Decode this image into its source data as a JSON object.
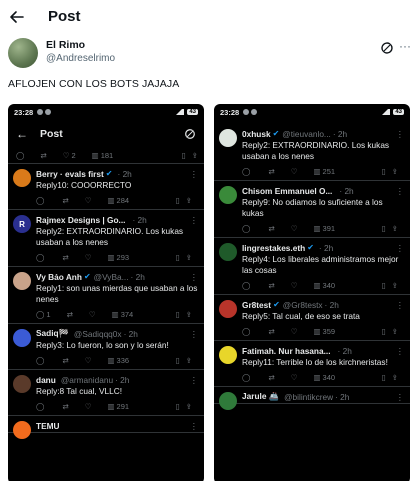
{
  "header": {
    "title": "Post"
  },
  "author": {
    "name": "El Rimo",
    "handle": "@Andreselrimo"
  },
  "tweet": {
    "text": "AFLOJEN CON LOS BOTS JAJAJA"
  },
  "screenshots": {
    "left": {
      "status_time": "23:28",
      "battery": "43",
      "nav_title": "Post",
      "top_actions": {
        "likes": "2",
        "views": "181"
      },
      "replies": [
        {
          "name": "Berry · evals first",
          "badge": "✔",
          "handle": "",
          "time": "· 2h",
          "text": "Reply10: COOORRECTO",
          "replies": "",
          "views": "284",
          "avatar_color": "#d97a1a",
          "avatar_glyph": ""
        },
        {
          "name": "Rajmex Designs | Go...",
          "badge": "",
          "handle": "",
          "time": "· 2h",
          "text": "Reply2: EXTRAORDINARIO. Los kukas usaban a los nenes",
          "replies": "",
          "views": "293",
          "avatar_color": "#2a2f8f",
          "avatar_glyph": "R"
        },
        {
          "name": "Vy Bảo Anh",
          "badge": "✔",
          "handle": "@VyBa...",
          "time": "· 2h",
          "text": "Reply1: son unas mierdas que usaban a los nenes",
          "replies": "1",
          "views": "374",
          "avatar_color": "#c9a38a",
          "avatar_glyph": ""
        },
        {
          "name": "Sadiq🏁",
          "badge": "",
          "handle": "@Sadiqqq0x",
          "time": "· 2h",
          "text": "Reply3: Lo fueron, lo son y lo serán!",
          "replies": "",
          "views": "336",
          "avatar_color": "#3b5bd6",
          "avatar_glyph": ""
        },
        {
          "name": "danu",
          "badge": "",
          "handle": "@armanidanu",
          "time": "· 2h",
          "text": "Reply:8 Tal cual, VLLC!",
          "replies": "",
          "views": "291",
          "avatar_color": "#5a3a2a",
          "avatar_glyph": ""
        },
        {
          "name": "TEMU",
          "badge": "",
          "handle": "",
          "time": "",
          "text": "",
          "replies": "",
          "views": "",
          "avatar_color": "#f26b1d",
          "avatar_glyph": ""
        }
      ]
    },
    "right": {
      "status_time": "23:28",
      "battery": "43",
      "replies": [
        {
          "name": "0xhusk",
          "badge": "✔",
          "handle": "@tieuvanlo...",
          "time": "· 2h",
          "text": "Reply2: EXTRAORDINARIO. Los kukas usaban a los nenes",
          "replies": "",
          "views": "251",
          "avatar_color": "#dfe6e0",
          "avatar_glyph": ""
        },
        {
          "name": "Chisom Emmanuel O...",
          "badge": "",
          "handle": "",
          "time": "· 2h",
          "text": "Reply9: No odiamos lo suficiente a los kukas",
          "replies": "",
          "views": "391",
          "avatar_color": "#3a8a3a",
          "avatar_glyph": ""
        },
        {
          "name": "lingrestakes.eth",
          "badge": "✔",
          "handle": "",
          "time": "· 2h",
          "text": "Reply4: Los liberales administramos mejor las cosas",
          "replies": "",
          "views": "340",
          "avatar_color": "#1f5a2a",
          "avatar_glyph": ""
        },
        {
          "name": "Gr8test",
          "badge": "✔",
          "handle": "@Gr8testx",
          "time": "· 2h",
          "text": "Reply5: Tal cual, de eso se trata",
          "replies": "",
          "views": "359",
          "avatar_color": "#b8342a",
          "avatar_glyph": ""
        },
        {
          "name": "Fatimah. Nur hasana...",
          "badge": "",
          "handle": "",
          "time": "· 2h",
          "text": "Reply11: Terrible lo de los kirchneristas!",
          "replies": "",
          "views": "340",
          "avatar_color": "#e8d62a",
          "avatar_glyph": ""
        },
        {
          "name": "Jarule 🚢",
          "badge": "",
          "handle": "@bilintikcrew",
          "time": "· 2h",
          "text": "",
          "replies": "",
          "views": "",
          "avatar_color": "#2f7a3a",
          "avatar_glyph": ""
        }
      ]
    }
  }
}
